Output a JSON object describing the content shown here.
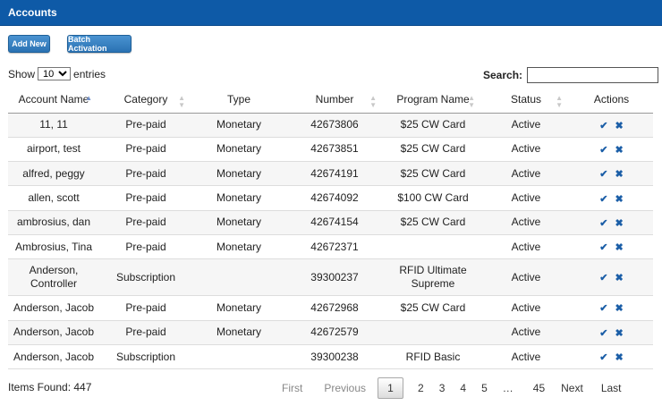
{
  "header": {
    "title": "Accounts"
  },
  "toolbar": {
    "add_new": "Add New",
    "batch_activation": "Batch Activation"
  },
  "length": {
    "show_label": "Show",
    "selected": "10",
    "entries_label": "entries"
  },
  "search": {
    "label": "Search:",
    "value": ""
  },
  "table": {
    "columns": [
      "Account Name",
      "Category",
      "Type",
      "Number",
      "Program Name",
      "Status",
      "Actions"
    ],
    "rows": [
      {
        "name": "11, 11",
        "category": "Pre-paid",
        "type": "Monetary",
        "number": "42673806",
        "program": "$25 CW Card",
        "status": "Active"
      },
      {
        "name": "airport, test",
        "category": "Pre-paid",
        "type": "Monetary",
        "number": "42673851",
        "program": "$25 CW Card",
        "status": "Active"
      },
      {
        "name": "alfred, peggy",
        "category": "Pre-paid",
        "type": "Monetary",
        "number": "42674191",
        "program": "$25 CW Card",
        "status": "Active"
      },
      {
        "name": "allen, scott",
        "category": "Pre-paid",
        "type": "Monetary",
        "number": "42674092",
        "program": "$100 CW Card",
        "status": "Active"
      },
      {
        "name": "ambrosius, dan",
        "category": "Pre-paid",
        "type": "Monetary",
        "number": "42674154",
        "program": "$25 CW Card",
        "status": "Active"
      },
      {
        "name": "Ambrosius, Tina",
        "category": "Pre-paid",
        "type": "Monetary",
        "number": "42672371",
        "program": "",
        "status": "Active"
      },
      {
        "name": "Anderson, Controller",
        "category": "Subscription",
        "type": "",
        "number": "39300237",
        "program": "RFID Ultimate Supreme",
        "status": "Active"
      },
      {
        "name": "Anderson, Jacob",
        "category": "Pre-paid",
        "type": "Monetary",
        "number": "42672968",
        "program": "$25 CW Card",
        "status": "Active"
      },
      {
        "name": "Anderson, Jacob",
        "category": "Pre-paid",
        "type": "Monetary",
        "number": "42672579",
        "program": "",
        "status": "Active"
      },
      {
        "name": "Anderson, Jacob",
        "category": "Subscription",
        "type": "",
        "number": "39300238",
        "program": "RFID Basic",
        "status": "Active"
      }
    ],
    "action_icons": [
      "check-icon",
      "delete-icon"
    ]
  },
  "footer": {
    "items_found": "Items Found: 447"
  },
  "pagination": {
    "first": "First",
    "previous": "Previous",
    "pages": [
      "1",
      "2",
      "3",
      "4",
      "5",
      "…",
      "45"
    ],
    "current": "1",
    "next": "Next",
    "last": "Last"
  },
  "colors": {
    "header_bg": "#0e5aa7",
    "button_bg": "#2f7fc1",
    "icon": "#1b5ea7"
  }
}
